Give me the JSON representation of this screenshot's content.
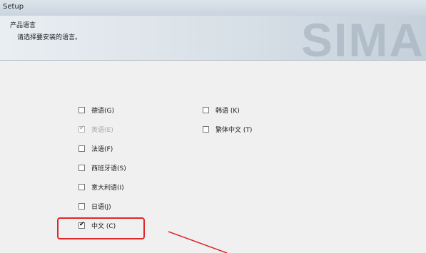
{
  "window": {
    "title": "Setup"
  },
  "banner": {
    "heading": "产品语言",
    "subheading": "请选择要安装的语言。",
    "logo_text": "SIMA"
  },
  "languages": [
    {
      "label": "德语(G)",
      "checked": false,
      "disabled": false
    },
    {
      "label": "英语(E)",
      "checked": true,
      "disabled": true
    },
    {
      "label": "法语(F)",
      "checked": false,
      "disabled": false
    },
    {
      "label": "西班牙语(S)",
      "checked": false,
      "disabled": false
    },
    {
      "label": "意大利语(I)",
      "checked": false,
      "disabled": false
    },
    {
      "label": "日语(J)",
      "checked": false,
      "disabled": false
    },
    {
      "label": "中文 (C)",
      "checked": true,
      "disabled": false
    },
    {
      "label": "韩语 (K)",
      "checked": false,
      "disabled": false
    },
    {
      "label": "繁体中文 (T)",
      "checked": false,
      "disabled": false
    }
  ],
  "colors": {
    "highlight": "#e0262a"
  }
}
